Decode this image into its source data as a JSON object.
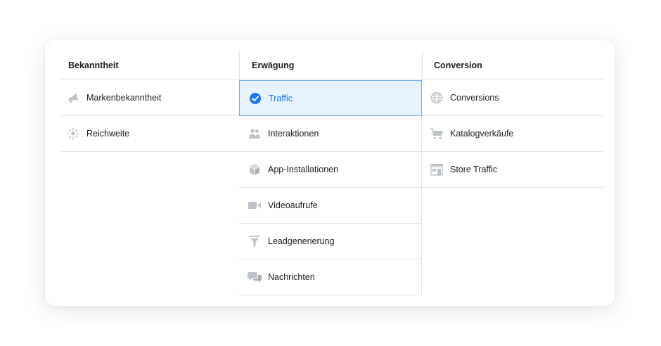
{
  "columns": [
    {
      "header": "Bekanntheit",
      "items": [
        {
          "label": "Markenbekanntheit",
          "icon": "megaphone-icon"
        },
        {
          "label": "Reichweite",
          "icon": "reach-icon"
        }
      ]
    },
    {
      "header": "Erwägung",
      "items": [
        {
          "label": "Traffic",
          "icon": "check-circle-icon",
          "selected": true
        },
        {
          "label": "Interaktionen",
          "icon": "people-icon"
        },
        {
          "label": "App-Installationen",
          "icon": "box-icon"
        },
        {
          "label": "Videoaufrufe",
          "icon": "video-camera-icon"
        },
        {
          "label": "Leadgenerierung",
          "icon": "funnel-icon"
        },
        {
          "label": "Nachrichten",
          "icon": "chat-bubbles-icon"
        }
      ]
    },
    {
      "header": "Conversion",
      "items": [
        {
          "label": "Conversions",
          "icon": "globe-icon"
        },
        {
          "label": "Katalogverkäufe",
          "icon": "shopping-cart-icon"
        },
        {
          "label": "Store Traffic",
          "icon": "store-icon"
        }
      ]
    }
  ],
  "colors": {
    "accent": "#1877f2",
    "selected_bg": "#e7f3ff",
    "icon_gray": "#bec3c9",
    "border": "#dfe2e6"
  }
}
